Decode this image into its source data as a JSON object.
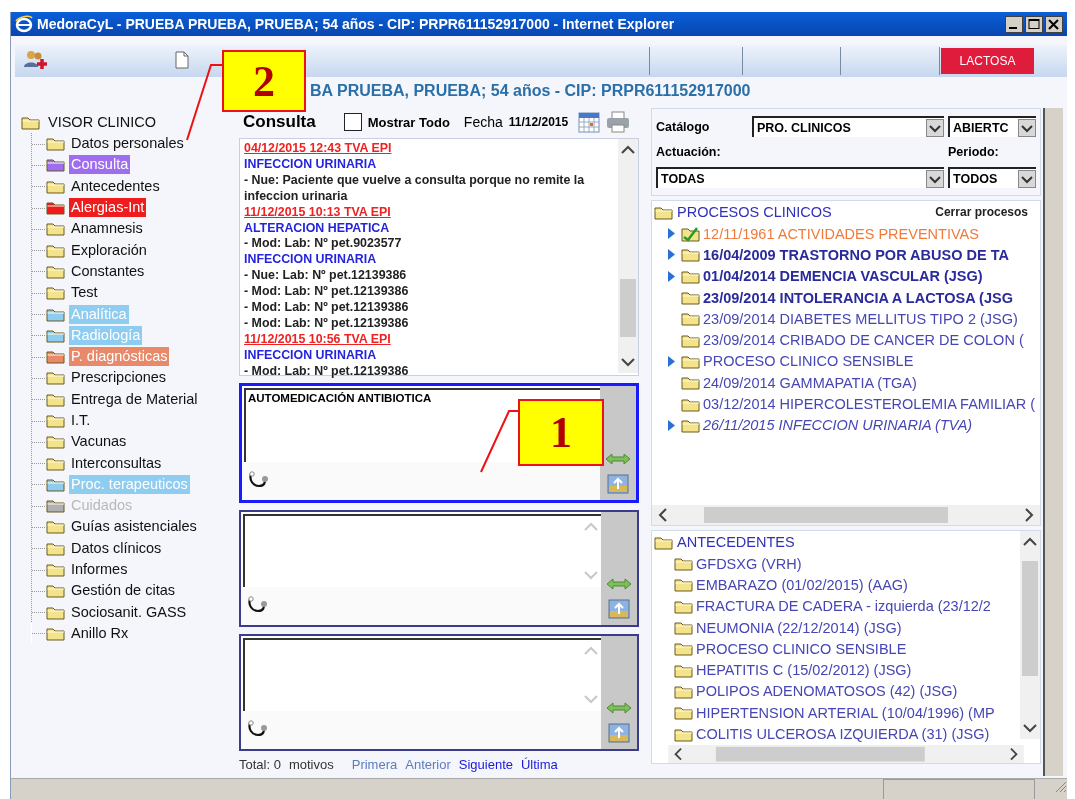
{
  "window": {
    "title": "MedoraCyL - PRUEBA PRUEBA, PRUEBA; 54 años - CIP: PRPR611152917000 - Internet Explorer"
  },
  "toolbar": {
    "alert_badge": "LACTOSA"
  },
  "patient_header": "BA PRUEBA, PRUEBA; 54 años - CIP: PRPR611152917000",
  "sidebar": {
    "root": "VISOR CLINICO",
    "children": [
      {
        "label": "Datos personales",
        "disabled": false
      },
      {
        "label": "Consulta",
        "disabled": false,
        "color": "#9f6ef0"
      },
      {
        "label": "Antecedentes",
        "disabled": false
      },
      {
        "label": "Alergias-Int",
        "disabled": false,
        "color": "#ee1c1c"
      },
      {
        "label": "Anamnesis",
        "disabled": false
      },
      {
        "label": "Exploración",
        "disabled": false
      },
      {
        "label": "Constantes",
        "disabled": false
      },
      {
        "label": "Test",
        "disabled": false
      },
      {
        "label": "Analítica",
        "disabled": false,
        "color": "#8fcdf0"
      },
      {
        "label": "Radiología",
        "disabled": false,
        "color": "#8fcdf0"
      },
      {
        "label": "P. diagnósticas",
        "disabled": false,
        "color": "#e8896a"
      },
      {
        "label": "Prescripciones",
        "disabled": false
      },
      {
        "label": "Entrega de Material",
        "disabled": false
      },
      {
        "label": "I.T.",
        "disabled": false
      },
      {
        "label": "Vacunas",
        "disabled": false
      },
      {
        "label": "Interconsultas",
        "disabled": false
      },
      {
        "label": "Proc. terapeuticos",
        "disabled": false,
        "color": "#8fcdf0"
      },
      {
        "label": "Cuidados",
        "disabled": true
      },
      {
        "label": "Guías asistenciales",
        "disabled": false
      },
      {
        "label": "Datos clínicos",
        "disabled": false
      },
      {
        "label": "Informes",
        "disabled": false
      },
      {
        "label": "Gestión de citas",
        "disabled": false
      },
      {
        "label": "Sociosanit. GASS",
        "disabled": false
      },
      {
        "label": "Anillo Rx",
        "disabled": false
      }
    ]
  },
  "consulta": {
    "title": "Consulta",
    "show_all": {
      "label": "Mostrar Todo",
      "checked": false
    },
    "date_label": "Fecha",
    "date": "11/12/2015",
    "notes": [
      {
        "kind": "date",
        "text": "04/12/2015 12:43 TVA EPI"
      },
      {
        "kind": "problem",
        "text": "INFECCION URINARIA"
      },
      {
        "kind": "entry",
        "text": "- Nue: Paciente que vuelve a consulta porque no remite la infeccion urinaria"
      },
      {
        "kind": "date",
        "text": "11/12/2015 10:13 TVA EPI"
      },
      {
        "kind": "problem",
        "text": "ALTERACION HEPATICA"
      },
      {
        "kind": "entry",
        "text": "- Mod: Lab: Nº pet.9023577"
      },
      {
        "kind": "problem",
        "text": "INFECCION URINARIA"
      },
      {
        "kind": "entry",
        "text": "- Nue: Lab: Nº pet.12139386"
      },
      {
        "kind": "entry",
        "text": "- Mod: Lab: Nº pet.12139386"
      },
      {
        "kind": "entry",
        "text": "- Mod: Lab: Nº pet.12139386"
      },
      {
        "kind": "entry",
        "text": "- Mod: Lab: Nº pet.12139386"
      },
      {
        "kind": "date",
        "text": "11/12/2015 10:56 TVA EPI"
      },
      {
        "kind": "problem",
        "text": "INFECCION URINARIA"
      },
      {
        "kind": "entry",
        "text": "- Mod: Lab: Nº pet.12139386"
      }
    ],
    "reasons": [
      {
        "value": "AUTOMEDICACIÓN ANTIBIOTICA",
        "selected": true
      },
      {
        "selected": false
      },
      {
        "selected": false
      }
    ],
    "total": "Total: 0",
    "total_unit": "motivos",
    "pager": [
      {
        "label": "Primera",
        "disabled": true
      },
      {
        "label": "Anterior",
        "disabled": true
      },
      {
        "label": "Siguiente",
        "disabled": false
      },
      {
        "label": "Última",
        "disabled": false
      }
    ]
  },
  "filters": {
    "catalog_label": "Catálogo",
    "catalog": "PRO. CLINICOS",
    "state": "ABIERTC",
    "action_label": "Actuación:",
    "action": "TODAS",
    "period_label": "Periodo:",
    "period": "TODOS"
  },
  "processes": {
    "title": "PROCESOS CLINICOS",
    "close_link": "Cerrar procesos",
    "items": [
      {
        "kind": "preventive",
        "label": "12/11/1961 ACTIVIDADES PREVENTIVAS",
        "expandable": true
      },
      {
        "kind": "bold",
        "label": "16/04/2009 TRASTORNO POR ABUSO DE TA",
        "expandable": true
      },
      {
        "kind": "bold",
        "label": "01/04/2014 DEMENCIA VASCULAR (JSG)",
        "expandable": true
      },
      {
        "kind": "bold",
        "label": "23/09/2014 INTOLERANCIA A LACTOSA (JSG",
        "expandable": false
      },
      {
        "kind": "normal",
        "label": "23/09/2014 DIABETES MELLITUS TIPO 2 (JSG)",
        "expandable": false
      },
      {
        "kind": "normal",
        "label": "23/09/2014 CRIBADO DE CANCER DE COLON (",
        "expandable": false
      },
      {
        "kind": "normal",
        "label": "PROCESO CLINICO SENSIBLE",
        "expandable": true
      },
      {
        "kind": "normal",
        "label": "24/09/2014 GAMMAPATIA (TGA)",
        "expandable": false
      },
      {
        "kind": "normal",
        "label": "03/12/2014 HIPERCOLESTEROLEMIA FAMILIAR (",
        "expandable": false
      },
      {
        "kind": "italic",
        "label": "26/11/2015 INFECCION URINARIA (TVA)",
        "expandable": true
      }
    ]
  },
  "antecedentes": {
    "title": "ANTECEDENTES",
    "items": [
      "GFDSXG (VRH)",
      "EMBARAZO (01/02/2015) (AAG)",
      "FRACTURA DE CADERA - izquierda (23/12/2",
      "NEUMONIA (22/12/2014) (JSG)",
      "PROCESO CLINICO SENSIBLE",
      "HEPATITIS C (15/02/2012) (JSG)",
      "POLIPOS ADENOMATOSOS (42) (JSG)",
      "HIPERTENSION ARTERIAL (10/04/1996) (MP",
      "COLITIS ULCEROSA IZQUIERDA (31) (JSG)"
    ]
  },
  "annotations": [
    {
      "label": "2"
    },
    {
      "label": "1"
    }
  ]
}
